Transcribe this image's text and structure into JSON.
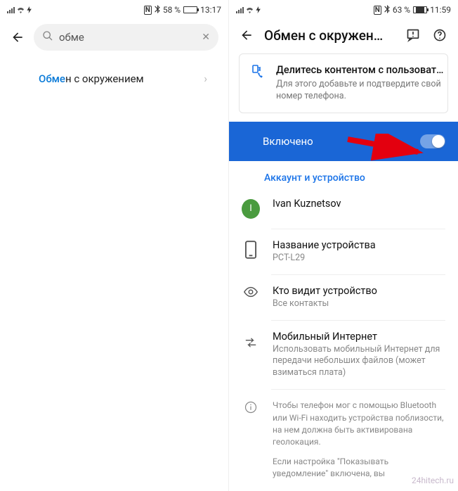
{
  "left": {
    "status": {
      "battery_pct": "58 %",
      "time": "13:17",
      "batt_fill": "58%"
    },
    "search": {
      "query": "обме"
    },
    "result": {
      "highlight": "Обме",
      "rest": "н с окружением"
    }
  },
  "right": {
    "status": {
      "battery_pct": "63 %",
      "time": "11:59",
      "batt_fill": "63%"
    },
    "header": {
      "title": "Обмен с окружен…"
    },
    "card": {
      "title": "Делитесь контентом с пользоват…",
      "sub": "Для этого добавьте и подтвердите свой номер телефона."
    },
    "toggle": {
      "label": "Включено"
    },
    "section": {
      "title": "Аккаунт и устройство"
    },
    "account": {
      "name": "Ivan Kuznetsov",
      "initial": "I"
    },
    "device": {
      "title": "Название устройства",
      "value": "PCT-L29"
    },
    "visibility": {
      "title": "Кто видит устройство",
      "value": "Все контакты"
    },
    "mobile": {
      "title": "Мобильный Интернет",
      "sub": "Использовать мобильный Интернет для передачи небольших файлов (может взиматься плата)"
    },
    "info": {
      "p1": "Чтобы телефон мог с помощью Bluetooth или Wi-Fi находить устройства поблизости, на нем должна быть активирована геолокация.",
      "p2": "Если настройка \"Показывать уведомление\" включена, вы"
    }
  },
  "watermark": "24hitech.ru"
}
